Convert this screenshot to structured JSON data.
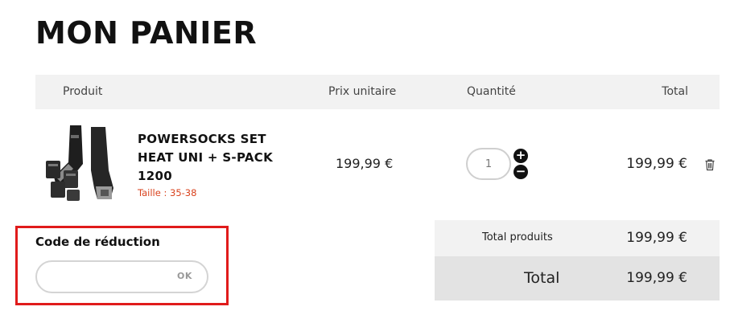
{
  "page": {
    "title": "MON PANIER"
  },
  "table_header": {
    "product": "Produit",
    "unit_price": "Prix unitaire",
    "quantity": "Quantité",
    "total": "Total"
  },
  "cart_item": {
    "name": "POWERSOCKS SET HEAT UNI + S-PACK 1200",
    "size": "Taille : 35-38",
    "unit_price": "199,99 €",
    "quantity": "1",
    "line_total": "199,99 €",
    "plus_label": "+",
    "minus_label": "−",
    "remove_icon": "trash-icon"
  },
  "promo": {
    "label": "Code de réduction",
    "input_value": "",
    "ok_label": "OK"
  },
  "summary": {
    "products_label": "Total produits",
    "products_value": "199,99 €",
    "total_label": "Total",
    "total_value": "199,99 €"
  },
  "colors": {
    "accent_red": "#e01b1b",
    "size_orange": "#d9431e",
    "header_bg": "#f2f2f2",
    "total_bg": "#e3e3e3"
  }
}
